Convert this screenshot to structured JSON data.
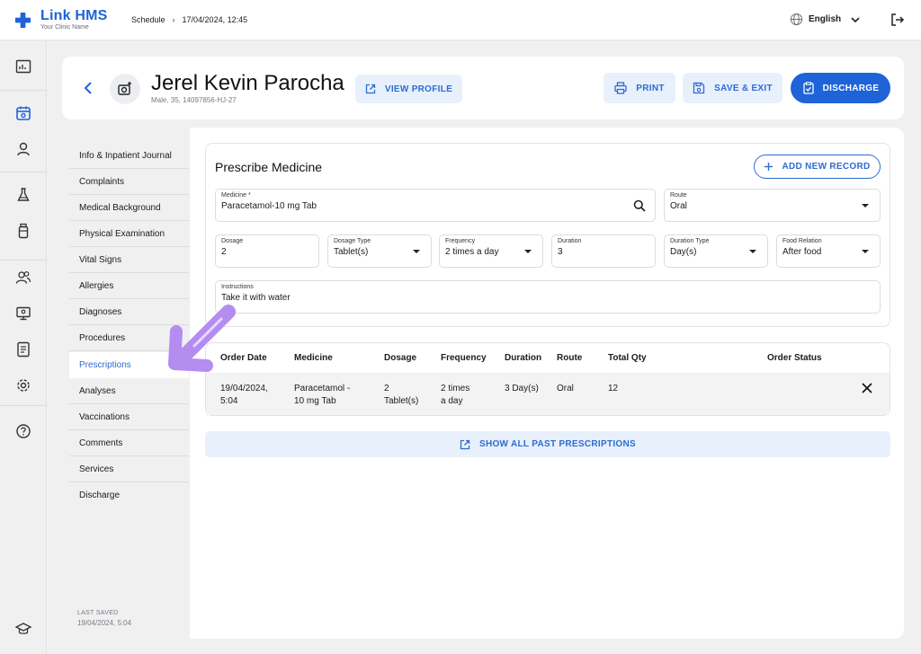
{
  "app": {
    "name": "Link HMS",
    "tagline": "Your Clinic Name"
  },
  "breadcrumb": {
    "section": "Schedule",
    "separator": "›",
    "datetime": "17/04/2024, 12:45"
  },
  "language": {
    "selected": "English"
  },
  "rail_icons": [
    "dashboard-icon",
    "calendar-icon",
    "person-icon",
    "flask-icon",
    "bottle-icon",
    "people-icon",
    "monitor-icon",
    "report-icon",
    "settings-icon",
    "help-icon",
    "graduation-cap-icon"
  ],
  "patient": {
    "name": "Jerel Kevin Parocha",
    "meta": "Male, 35, 14097856-HJ-27",
    "view_profile": "VIEW PROFILE"
  },
  "actions": {
    "print": "PRINT",
    "save_exit": "SAVE & EXIT",
    "discharge": "DISCHARGE"
  },
  "sidebar": {
    "items": [
      {
        "label": "Info & Inpatient Journal"
      },
      {
        "label": "Complaints"
      },
      {
        "label": "Medical Background"
      },
      {
        "label": "Physical Examination"
      },
      {
        "label": "Vital Signs"
      },
      {
        "label": "Allergies"
      },
      {
        "label": "Diagnoses"
      },
      {
        "label": "Procedures"
      },
      {
        "label": "Prescriptions"
      },
      {
        "label": "Analyses"
      },
      {
        "label": "Vaccinations"
      },
      {
        "label": "Comments"
      },
      {
        "label": "Services"
      },
      {
        "label": "Discharge"
      }
    ],
    "active": "Prescriptions",
    "last_saved_label": "LAST SAVED",
    "last_saved_value": "19/04/2024, 5:04"
  },
  "prescribe": {
    "title": "Prescribe Medicine",
    "add_button": "ADD NEW RECORD",
    "medicine": {
      "label": "Medicine *",
      "value": "Paracetamol-10 mg Tab"
    },
    "route": {
      "label": "Route",
      "value": "Oral"
    },
    "dosage": {
      "label": "Dosage",
      "value": "2"
    },
    "dosage_type": {
      "label": "Dosage Type",
      "value": "Tablet(s)"
    },
    "frequency": {
      "label": "Frequency",
      "value": "2 times a day"
    },
    "duration": {
      "label": "Duration",
      "value": "3"
    },
    "duration_type": {
      "label": "Duration Type",
      "value": "Day(s)"
    },
    "food_relation": {
      "label": "Food Relation",
      "value": "After food"
    },
    "instructions": {
      "label": "Instructions",
      "value": "Take it with water"
    }
  },
  "orders": {
    "columns": [
      "Order Date",
      "Medicine",
      "Dosage",
      "Frequency",
      "Duration",
      "Route",
      "Total Qty",
      "Order Status"
    ],
    "rows": [
      {
        "order_date_1": "19/04/2024,",
        "order_date_2": "5:04",
        "medicine_1": "Paracetamol -",
        "medicine_2": "10 mg Tab",
        "dosage_1": "2",
        "dosage_2": "Tablet(s)",
        "frequency_1": "2 times",
        "frequency_2": "a day",
        "duration": "3 Day(s)",
        "route": "Oral",
        "total_qty": "12",
        "order_status": ""
      }
    ]
  },
  "show_all_past": "SHOW ALL PAST PRESCRIPTIONS",
  "colors": {
    "accent": "#1f63d9",
    "soft_button": "#e8f0fb",
    "callout_arrow": "#b58cf0"
  }
}
